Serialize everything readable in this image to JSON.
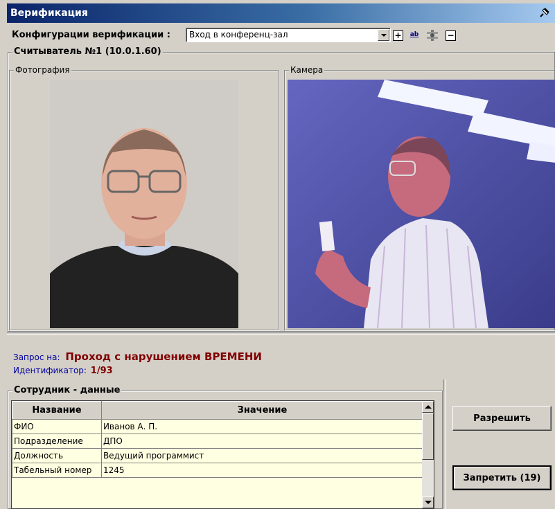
{
  "window": {
    "title": "Верификация",
    "pin_icon": "pushpin-icon"
  },
  "toolbar": {
    "config_label": "Конфигурации верификации :",
    "config_value": "Вход в конференц-зал",
    "buttons": [
      {
        "icon": "add-icon",
        "text": "+"
      },
      {
        "icon": "rename-icon",
        "text": "ab"
      },
      {
        "icon": "settings-icon",
        "text": ""
      },
      {
        "icon": "remove-icon",
        "text": "−"
      }
    ]
  },
  "reader": {
    "title": "Считыватель №1 (10.0.1.60)",
    "photo_label": "Фотография",
    "camera_label": "Камера"
  },
  "request": {
    "label": "Запрос на:",
    "value": "Проход с нарушением ВРЕМЕНИ",
    "id_label": "Идентификатор:",
    "id_value": "1/93"
  },
  "employee": {
    "title": "Сотрудник - данные",
    "columns": [
      "Название",
      "Значение"
    ],
    "rows": [
      [
        "ФИО",
        "Иванов А. П."
      ],
      [
        "Подразделение",
        "ДПО"
      ],
      [
        "Должность",
        "Ведущий программист"
      ],
      [
        "Табельный номер",
        "1245"
      ]
    ]
  },
  "actions": {
    "allow": "Разрешить",
    "deny": "Запретить (19)"
  },
  "colors": {
    "title_bar": "#0a246a",
    "request_value": "#800000",
    "label_blue": "#0000a0",
    "grid_bg": "#ffffe1"
  }
}
